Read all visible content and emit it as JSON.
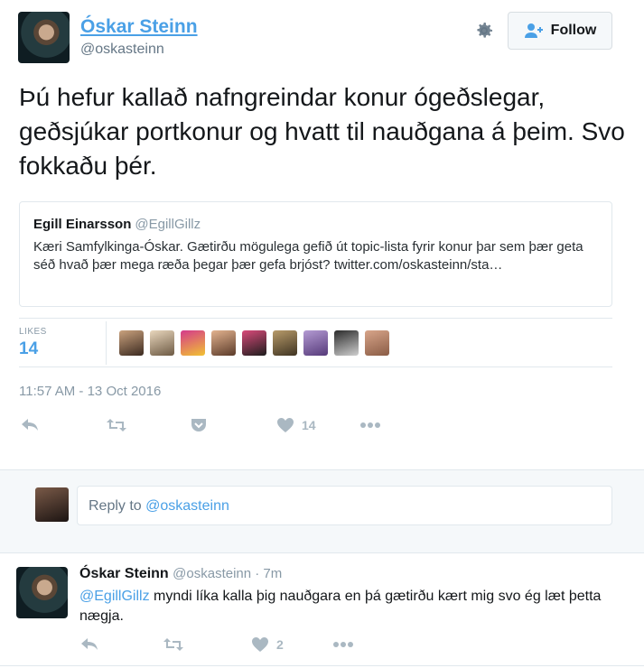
{
  "tweet": {
    "author_name": "Óskar Steinn",
    "author_handle": "@oskasteinn",
    "follow_label": "Follow",
    "text": "Þú hefur kallað nafngreindar konur ógeðslegar, geðsjúkar portkonur og hvatt til nauðgana á þeim. Svo fokkaðu þér.",
    "quoted": {
      "name": "Egill Einarsson",
      "handle": "@EgillGillz",
      "text": "Kæri Samfylkinga-Óskar. Gætirðu mögulega gefið út topic-lista fyrir konur þar sem þær geta séð hvað þær mega ræða þegar þær gefa brjóst? twitter.com/oskasteinn/sta…"
    },
    "likes_label": "LIKES",
    "likes_count": "14",
    "timestamp": "11:57 AM - 13 Oct 2016",
    "actions": {
      "like_count": "14"
    }
  },
  "reply_box": {
    "prefix": "Reply to ",
    "mention": "@oskasteinn"
  },
  "reply": {
    "author_name": "Óskar Steinn",
    "handle_time": "@oskasteinn · 7m",
    "mention": "@EgillGillz",
    "text": " myndi líka kalla þig nauðgara en þá gætirðu kært mig svo ég læt þetta nægja.",
    "like_count": "2"
  },
  "colors": {
    "link_blue": "#4aa0e6",
    "muted": "#8899a6",
    "icon_gray": "#aab8c2"
  }
}
